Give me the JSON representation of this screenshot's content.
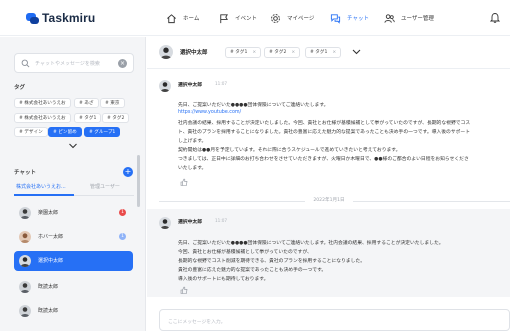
{
  "app": {
    "name": "Taskmiru"
  },
  "nav": {
    "home": "ホーム",
    "event": "イベント",
    "mypage": "マイページ",
    "chat": "チャット",
    "user_admin": "ユーザー管理"
  },
  "sidebar": {
    "search_placeholder": "チャットやメッセージを検索",
    "tags_label": "タグ",
    "tags": [
      "# 株式会社あいうえお",
      "# あざ",
      "# 東京",
      "# 株式会社あいうえお",
      "# タグ1",
      "# タグ2",
      "# デザイン",
      "# ピン留め",
      "# グループ1"
    ],
    "chat_label": "チャット",
    "tabs": [
      "株式会社あいうえお...",
      "管理ユーザー"
    ],
    "chats": [
      {
        "name": "楽園太郎",
        "badge": "1",
        "badge_color": "#e94b4b"
      },
      {
        "name": "ホバー太郎",
        "badge": "1",
        "badge_color": "#8fb3f8"
      },
      {
        "name": "選択中太郎",
        "badge": "",
        "badge_color": ""
      },
      {
        "name": "既読太郎",
        "badge": "",
        "badge_color": ""
      },
      {
        "name": "既読太郎",
        "badge": "",
        "badge_color": ""
      }
    ]
  },
  "chat": {
    "header_name": "選択中太郎",
    "header_tags": [
      "# タグ1",
      "# タグ2",
      "# タグ1"
    ],
    "date_separator": "2022年1月1日",
    "input_placeholder": "ここにメッセージを入力。",
    "messages": [
      {
        "name": "選択中太郎",
        "time": "11:07",
        "lines": [
          "先日、ご提案いただいた●●●●団体保険についてご連絡いたします。",
          "https://www.youtube.com/",
          "社内会議の結果、採用することが決定いたしました。今回、貴社とお仕様が基積候補として挙がっていたのですが、長期的な視野でコス",
          "ト、貴社のプランを採用することになりました。貴社の豊富に応えた魅力的な提案であったことも決め手の一つです。導入後のサポート",
          "し上げます。",
          "契約開始は●●月を予定しています。それに際に合うスケジュールで進めていきたいと考えております。",
          "つきましては、正日中に詳細のお打ち合わせをさせていただきますが、火曜日か木曜日で、●●様のご都合のよい日程をお知らせくださ",
          "いたします。"
        ]
      },
      {
        "name": "選択中太郎",
        "time": "11:07",
        "lines": [
          "先日、ご提案いただいた●●●●団体保険についてご連絡いたします。社内会議の結果、採用することが決定いたしました。",
          "今回、貴社とお仕様が基積候補として挙がっていたのですが、",
          "長期的な視野でコスト削減を期待できる、貴社のプランを採用することになりました。",
          "貴社の豊富に応えた魅力的な提案であったことも決め手の一つです。",
          "導入後のサポートにも期待しております。"
        ]
      }
    ]
  },
  "colors": {
    "accent": "#2670f5",
    "badge_red": "#e94b4b",
    "badge_blue": "#8fb3f8"
  }
}
